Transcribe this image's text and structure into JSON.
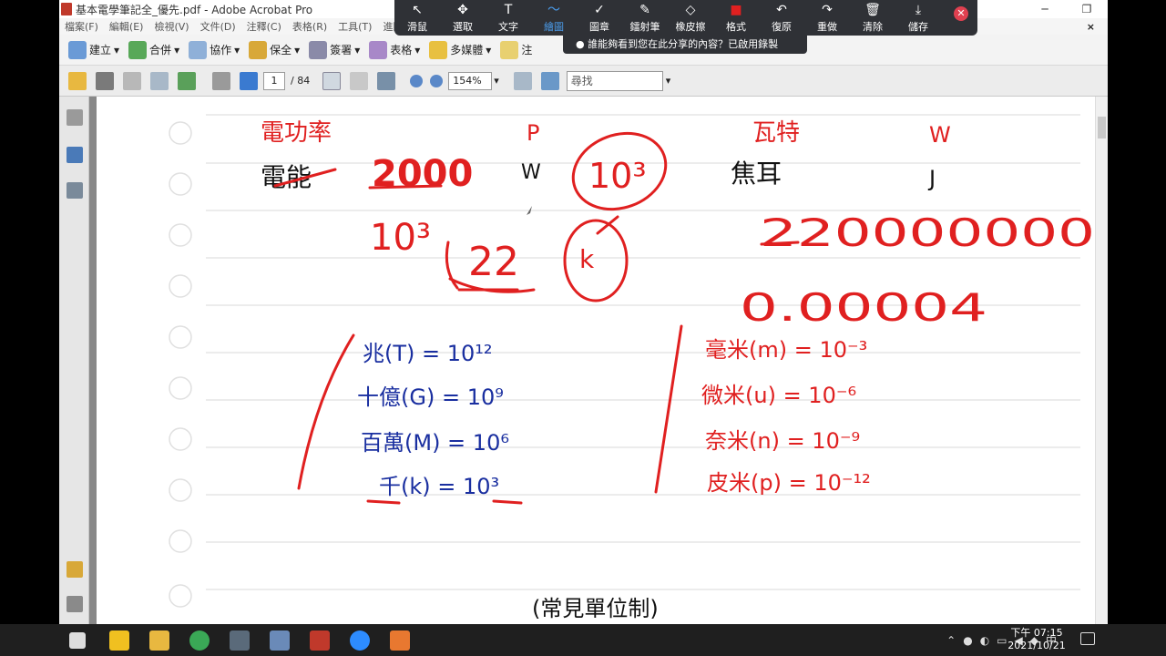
{
  "window": {
    "title": "基本電學筆記全_優先.pdf - Adobe Acrobat Pro"
  },
  "menu": [
    "檔案(F)",
    "編輯(E)",
    "檢視(V)",
    "文件(D)",
    "注釋(C)",
    "表格(R)",
    "工具(T)",
    "進階"
  ],
  "toolbar": {
    "create": "建立",
    "combine": "合併",
    "collaborate": "協作",
    "secure": "保全",
    "sign": "簽署",
    "forms": "表格",
    "multimedia": "多媒體",
    "comment": "注"
  },
  "nav": {
    "page_current": "1",
    "page_total": "/ 84",
    "zoom": "154%",
    "find_placeholder": "尋找"
  },
  "overlay": {
    "tools": [
      {
        "label": "滑鼠",
        "glyph": "↖"
      },
      {
        "label": "選取",
        "glyph": "✥"
      },
      {
        "label": "文字",
        "glyph": "T"
      },
      {
        "label": "繪圖",
        "glyph": "〜"
      },
      {
        "label": "圖章",
        "glyph": "✓"
      },
      {
        "label": "鐳射筆",
        "glyph": "✎"
      },
      {
        "label": "橡皮擦",
        "glyph": "◇"
      },
      {
        "label": "格式",
        "glyph": "■"
      },
      {
        "label": "復原",
        "glyph": "↶"
      },
      {
        "label": "重做",
        "glyph": "↷"
      },
      {
        "label": "清除",
        "glyph": "🗑"
      },
      {
        "label": "儲存",
        "glyph": "⤓"
      }
    ],
    "share_notice": "誰能夠看到您在此分享的內容？已啟用錄製"
  },
  "notes": {
    "row1": {
      "quantity": "電功率",
      "symbol": "P",
      "unit": "瓦特",
      "unit_symbol": "W"
    },
    "row2": {
      "quantity": "電能",
      "symbol": "W",
      "unit": "焦耳",
      "unit_symbol": "J"
    },
    "annotations": {
      "value_2000": "2000",
      "power_10_3": "10³",
      "power_10_3_left": "10³",
      "value_22": "22",
      "k_mark": "k",
      "big_number": "220000000",
      "small_number": "0.00004"
    },
    "large_prefixes": [
      {
        "text": "兆(T) = 10¹²"
      },
      {
        "text": "十億(G) = 10⁹"
      },
      {
        "text": "百萬(M) = 10⁶"
      },
      {
        "text": "千(k) = 10³"
      }
    ],
    "small_prefixes": [
      {
        "text": "毫米(m) = 10⁻³"
      },
      {
        "text": "微米(u) = 10⁻⁶"
      },
      {
        "text": "奈米(n) = 10⁻⁹"
      },
      {
        "text": "皮米(p) = 10⁻¹²"
      }
    ],
    "caption": "(常見單位制)"
  },
  "taskbar": {
    "time": "下午 07:15",
    "date": "2021/10/21",
    "ime": "中"
  },
  "colors": {
    "ink_red": "#e02020",
    "ink_blue": "#1a2fa0",
    "ink_black": "#111111",
    "acrobat_red": "#c0392b"
  }
}
